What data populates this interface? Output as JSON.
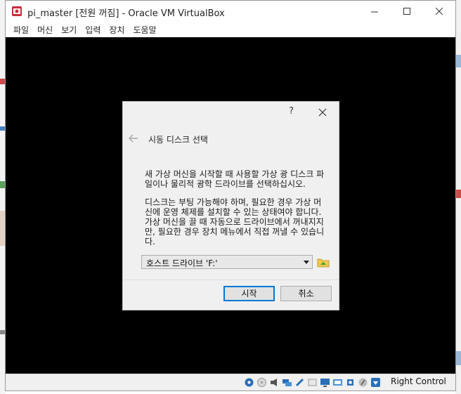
{
  "window": {
    "title": "pi_master [전원 꺼짐] - Oracle VM VirtualBox"
  },
  "menu": {
    "items": [
      "파일",
      "머신",
      "보기",
      "입력",
      "장치",
      "도움말"
    ]
  },
  "dialog": {
    "help_label": "?",
    "title": "시동 디스크 선택",
    "paragraph1": "새 가상 머신을 시작할 때 사용할 가상 광 디스크 파일이나 물리적 광학 드라이브를 선택하십시오.",
    "paragraph2": "디스크는 부팅 가능해야 하며, 필요한 경우 가상 머신에 운영 체제를 설치할 수 있는 상태여야 합니다. 가상 머신을 끌 때 자동으로 드라이브에서 꺼내지지만, 필요한 경우 장치 메뉴에서 직접 꺼낼 수 있습니다.",
    "drive_selected": "호스트 드라이브 'F:'",
    "start_label": "시작",
    "cancel_label": "취소"
  },
  "statusbar": {
    "icons": [
      "harddisk-icon",
      "optical-disk-icon",
      "audio-icon",
      "network-icon",
      "usb-icon",
      "shared-folder-icon",
      "display-icon",
      "recording-icon",
      "cpu-icon",
      "mouse-integration-icon",
      "host-key-arrow-icon"
    ],
    "host_key_label": "Right Control"
  },
  "colors": {
    "accent": "#0078d7",
    "vm_screen": "#000000",
    "dialog_bg": "#f0f0f0"
  }
}
